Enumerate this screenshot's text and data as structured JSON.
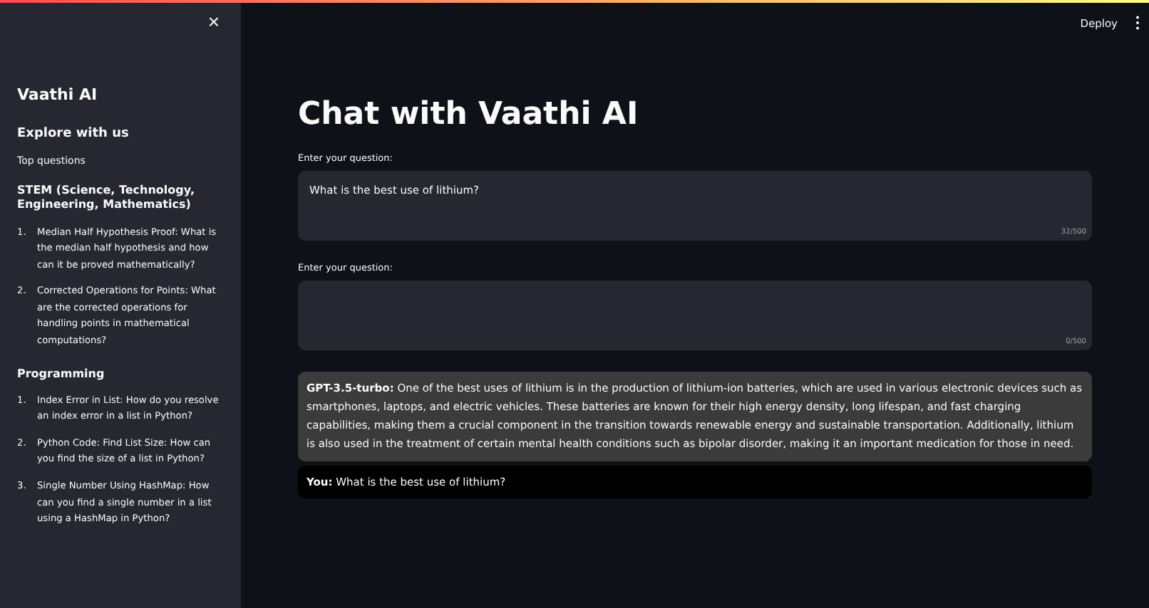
{
  "sidebar": {
    "close": "×",
    "title": "Vaathi AI",
    "heading": "Explore with us",
    "subheading": "Top questions",
    "sections": [
      {
        "title": "STEM (Science, Technology, Engineering, Mathematics)",
        "items": [
          {
            "marker": "1.",
            "text": "Median Half Hypothesis Proof: What is the median half hypothesis and how can it be proved mathematically?"
          },
          {
            "marker": "2.",
            "text": "Corrected Operations for Points: What are the corrected operations for handling points in mathematical computations?"
          }
        ]
      },
      {
        "title": "Programming",
        "items": [
          {
            "marker": "1.",
            "text": "Index Error in List: How do you resolve an index error in a list in Python?"
          },
          {
            "marker": "2.",
            "text": "Python Code: Find List Size: How can you find the size of a list in Python?"
          },
          {
            "marker": "3.",
            "text": "Single Number Using HashMap: How can you find a single number in a list using a HashMap in Python?"
          }
        ]
      }
    ]
  },
  "header": {
    "deploy": "Deploy"
  },
  "main": {
    "title": "Chat with Vaathi AI",
    "fields": [
      {
        "label": "Enter your question:",
        "value": "What is the best use of lithium?",
        "counter": "32/500"
      },
      {
        "label": "Enter your question:",
        "counter": "0/500"
      }
    ],
    "messages": [
      {
        "kind": "bot",
        "text": "**GPT-3.5-turbo:** One of the best uses of lithium is in the production of lithium-ion batteries, which are used in various electronic devices such as smartphones, laptops, and electric vehicles. These batteries are known for their high energy density, long lifespan, and fast charging capabilities, making them a crucial component in the transition towards renewable energy and sustainable transportation. Additionally, lithium is also used in the treatment of certain mental health conditions such as bipolar disorder, making it an important medication for those in need."
      },
      {
        "kind": "user",
        "text": "**You:** What is the best use of lithium?"
      }
    ]
  }
}
